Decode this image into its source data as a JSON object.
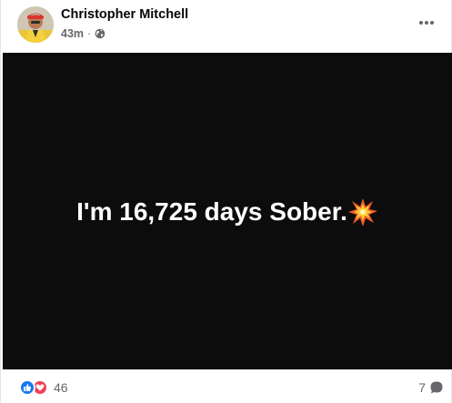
{
  "post": {
    "author": "Christopher Mitchell",
    "time": "43m",
    "separator": "·",
    "audience_icon": "globe-icon",
    "more_icon": "more-horizontal-icon",
    "content_text": "I'm 16,725 days Sober.",
    "content_emoji": "collision-emoji",
    "background_color": "#0c0c0c",
    "text_color": "#ffffff"
  },
  "footer": {
    "reaction_icons": [
      "like-icon",
      "love-icon"
    ],
    "reaction_count": "46",
    "comment_count": "7",
    "comment_icon": "comment-bubble-icon"
  },
  "colors": {
    "like": "#1877f2",
    "love": "#f33e58",
    "secondary_text": "#65676b"
  }
}
